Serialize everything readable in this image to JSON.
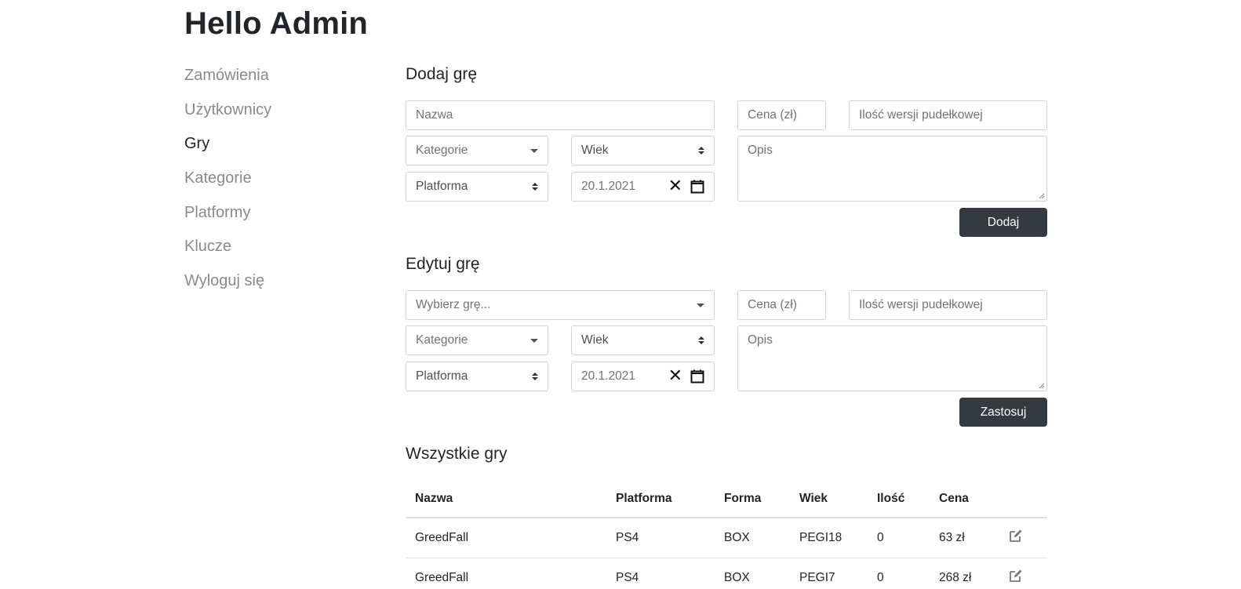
{
  "header": {
    "title": "Hello Admin"
  },
  "sidebar": {
    "items": [
      {
        "label": "Zamówienia",
        "active": false
      },
      {
        "label": "Użytkownicy",
        "active": false
      },
      {
        "label": "Gry",
        "active": true
      },
      {
        "label": "Kategorie",
        "active": false
      },
      {
        "label": "Platformy",
        "active": false
      },
      {
        "label": "Klucze",
        "active": false
      },
      {
        "label": "Wyloguj się",
        "active": false
      }
    ]
  },
  "add_game": {
    "title": "Dodaj grę",
    "name_placeholder": "Nazwa",
    "price_placeholder": "Cena (zł)",
    "box_qty_placeholder": "Ilość wersji pudełkowej",
    "category_placeholder": "Kategorie",
    "age_value": "Wiek",
    "description_placeholder": "Opis",
    "platform_value": "Platforma",
    "date_value": "20.1.2021",
    "submit_label": "Dodaj"
  },
  "edit_game": {
    "title": "Edytuj grę",
    "game_select_placeholder": "Wybierz grę...",
    "price_placeholder": "Cena (zł)",
    "box_qty_placeholder": "Ilość wersji pudełkowej",
    "category_placeholder": "Kategorie",
    "age_value": "Wiek",
    "description_placeholder": "Opis",
    "platform_value": "Platforma",
    "date_value": "20.1.2021",
    "submit_label": "Zastosuj"
  },
  "all_games": {
    "title": "Wszystkie gry",
    "columns": [
      "Nazwa",
      "Platforma",
      "Forma",
      "Wiek",
      "Ilość",
      "Cena"
    ],
    "rows": [
      {
        "name": "GreedFall",
        "platform": "PS4",
        "form": "BOX",
        "age": "PEGI18",
        "qty": "0",
        "price": "63 zł"
      },
      {
        "name": "GreedFall",
        "platform": "PS4",
        "form": "BOX",
        "age": "PEGI7",
        "qty": "0",
        "price": "268 zł"
      }
    ]
  },
  "icons": {
    "clear": "clear-icon",
    "calendar": "calendar-icon",
    "edit": "edit-icon"
  },
  "colors": {
    "button_bg": "#343a40",
    "muted_text": "#6c757d",
    "border": "#ced4da"
  }
}
